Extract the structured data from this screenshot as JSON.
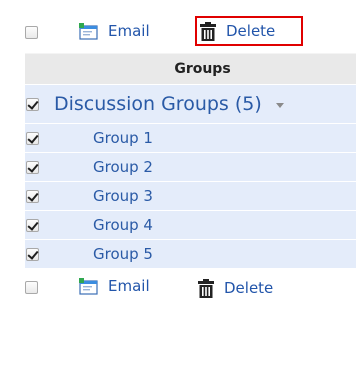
{
  "toolbar_top": {
    "email_label": "Email",
    "delete_label": "Delete",
    "delete_highlighted": true
  },
  "table": {
    "header": "Groups",
    "group": {
      "title": "Discussion Groups (5)",
      "checked": true
    },
    "items": [
      {
        "label": "Group 1",
        "checked": true
      },
      {
        "label": "Group 2",
        "checked": true
      },
      {
        "label": "Group 3",
        "checked": true
      },
      {
        "label": "Group 4",
        "checked": true
      },
      {
        "label": "Group 5",
        "checked": true
      }
    ]
  },
  "toolbar_bottom": {
    "email_label": "Email",
    "delete_label": "Delete"
  },
  "colors": {
    "highlight_border": "#e00000",
    "link_blue": "#2255aa",
    "row_background": "#e4ecfa",
    "header_background": "#e9e9e9"
  },
  "icons": [
    "email-icon",
    "trash-icon",
    "chevron-down-icon"
  ]
}
